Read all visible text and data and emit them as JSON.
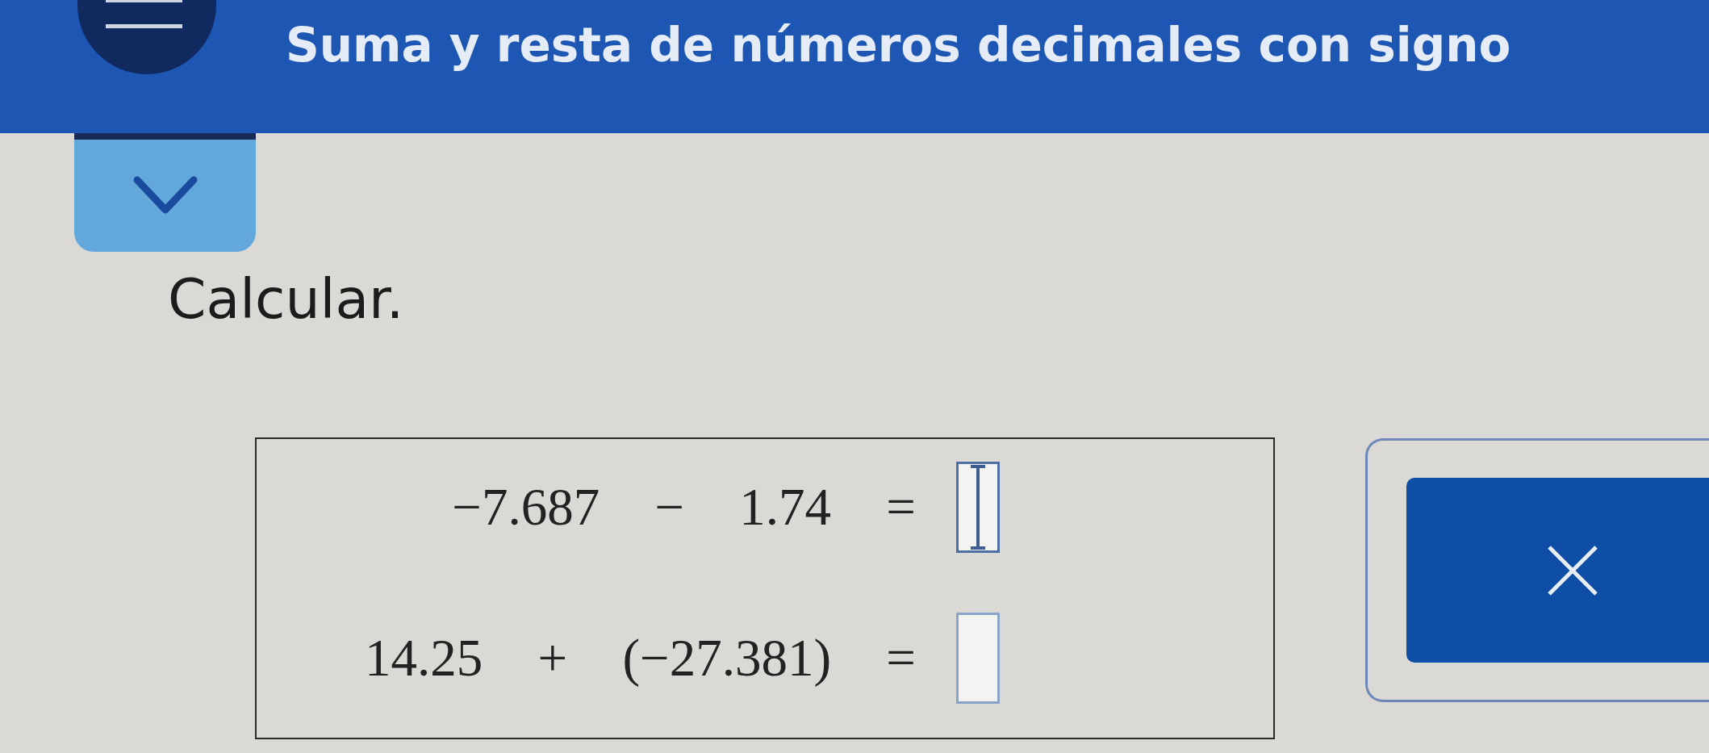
{
  "header": {
    "title": "Suma y resta de números decimales con signo"
  },
  "panel_toggle": {
    "expanded": false
  },
  "instruction": "Calcular.",
  "problems": [
    {
      "expression": "−7.687 − 1.74 =",
      "focused": true
    },
    {
      "expression": "14.25 + (−27.381) =",
      "focused": false
    }
  ]
}
